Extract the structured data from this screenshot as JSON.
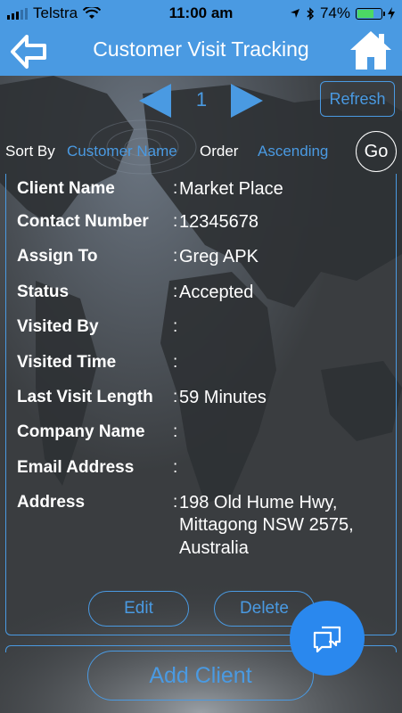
{
  "status_bar": {
    "carrier": "Telstra",
    "time": "11:00 am",
    "battery_percent": "74%",
    "battery_level": 0.74
  },
  "header": {
    "title": "Customer Visit Tracking"
  },
  "pager": {
    "page": "1",
    "refresh_label": "Refresh"
  },
  "sort": {
    "sort_by_label": "Sort By",
    "sort_by_value": "Customer Name",
    "order_label": "Order",
    "order_value": "Ascending",
    "go_label": "Go"
  },
  "record": {
    "fields": [
      {
        "label": "Client Name",
        "value": "Market Place"
      },
      {
        "label": "Contact Number",
        "value": "12345678"
      },
      {
        "label": "Assign To",
        "value": "Greg APK"
      },
      {
        "label": "Status",
        "value": "Accepted"
      },
      {
        "label": "Visited By",
        "value": ""
      },
      {
        "label": "Visited Time",
        "value": ""
      },
      {
        "label": "Last Visit Length",
        "value": "59 Minutes"
      },
      {
        "label": "Company Name",
        "value": ""
      },
      {
        "label": "Email Address",
        "value": ""
      },
      {
        "label": "Address",
        "value": "198 Old Hume Hwy,"
      }
    ],
    "address_line2": "Mittagong NSW 2575,",
    "address_line3": "Australia",
    "edit_label": "Edit",
    "delete_label": "Delete"
  },
  "add_client_label": "Add Client",
  "icons": {
    "back": "back-arrow-icon",
    "home": "home-icon",
    "prev": "triangle-left-icon",
    "next": "triangle-right-icon",
    "chat": "chat-icon"
  },
  "colors": {
    "accent": "#4a9ae2",
    "background": "#3a3d40",
    "fab": "#2a88ee"
  }
}
